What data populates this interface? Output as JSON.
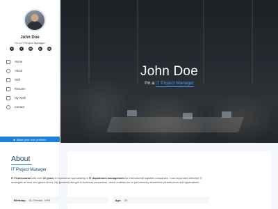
{
  "sidebar": {
    "name": "John Doe",
    "tagline": "I'm a IT Project Manager",
    "social": [
      "facebook",
      "twitter",
      "linkedin",
      "github",
      "instagram"
    ],
    "nav": [
      {
        "label": "Home",
        "icon": "home-icon"
      },
      {
        "label": "About",
        "icon": "user-icon"
      },
      {
        "label": "Skill",
        "icon": "chart-icon"
      },
      {
        "label": "Resume",
        "icon": "file-icon"
      },
      {
        "label": "My Work",
        "icon": "briefcase-icon"
      },
      {
        "label": "Contact",
        "icon": "phone-icon"
      }
    ],
    "cta": "Make your own portfolio"
  },
  "hero": {
    "title": "John Doe",
    "prefix": "I'm a",
    "role": "IT Project Manager"
  },
  "about": {
    "title": "About",
    "role": "IT Project Manager",
    "text_parts": {
      "p1_bold": "IT Professional",
      "p1_a": " with over ",
      "p1_years": "10 years",
      "p1_b": " of experience specializing in ",
      "p1_dept": "IT department management",
      "p1_c": " for international logistics companies. I can implement effective IT strategies at local and global levels. My greatest strength is business awareness, which enables me to permanently streamline infrastructure and applications."
    },
    "facts": [
      {
        "key": "Birthday:",
        "value": "01 October, 1993"
      },
      {
        "key": "Age:",
        "value": "29"
      }
    ]
  },
  "colors": {
    "accent": "#1f7fe0",
    "heading": "#173b6c",
    "hero_link": "#3d9bf5"
  }
}
